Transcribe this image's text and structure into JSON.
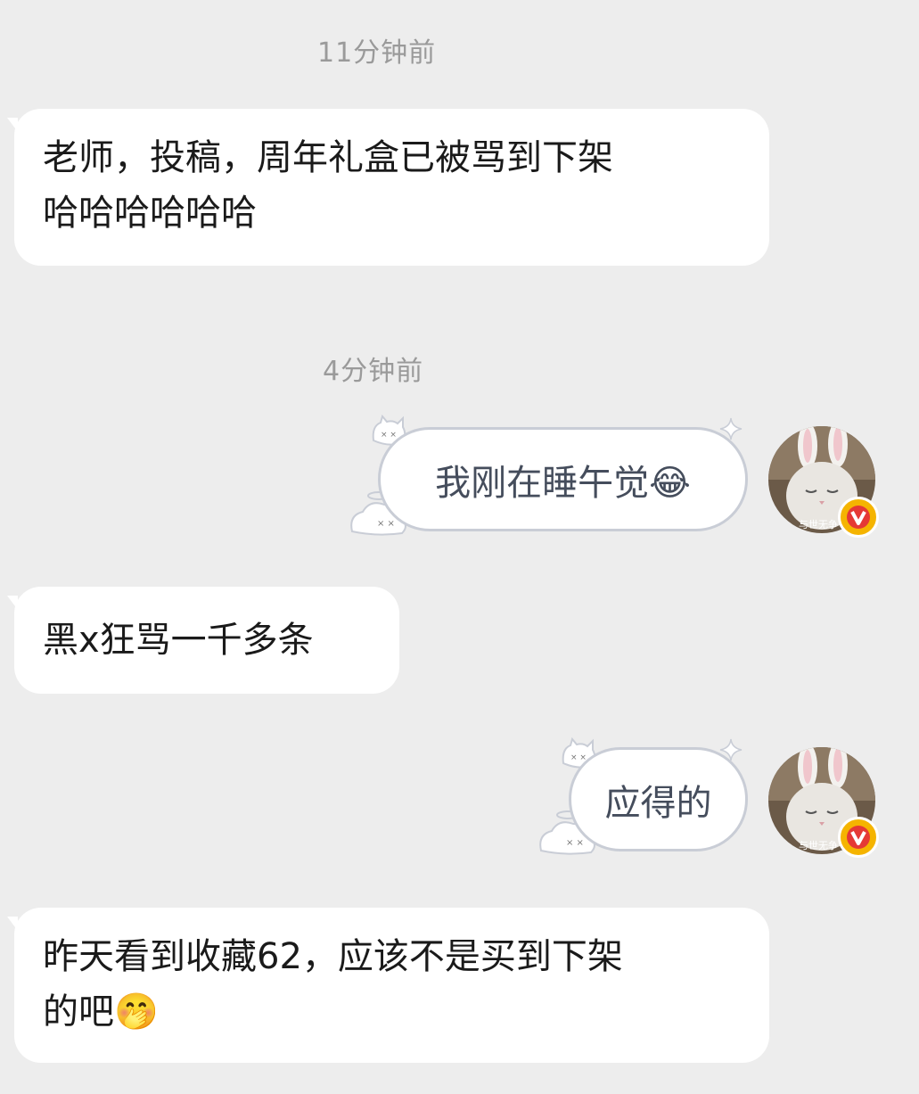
{
  "messages": [
    {
      "timestamp": "11分钟前"
    },
    {
      "line1": "老师，投稿，周年礼盒已被骂到下架",
      "line2": "哈哈哈哈哈哈"
    },
    {
      "timestamp": "4分钟前"
    },
    {
      "text": "我刚在睡午觉😂"
    },
    {
      "text": "黑x狂骂一千多条"
    },
    {
      "text": "应得的"
    },
    {
      "line1": "昨天看到收藏62，应该不是买到下架",
      "line2": "的吧🤭"
    }
  ],
  "avatar_caption": "与世无争",
  "colors": {
    "background": "#ededed",
    "incoming_bubble": "#ffffff",
    "outgoing_border": "#c9cdd6",
    "outgoing_text": "#454d5c",
    "timestamp": "#9a9a9a",
    "badge": "#f5b400"
  }
}
